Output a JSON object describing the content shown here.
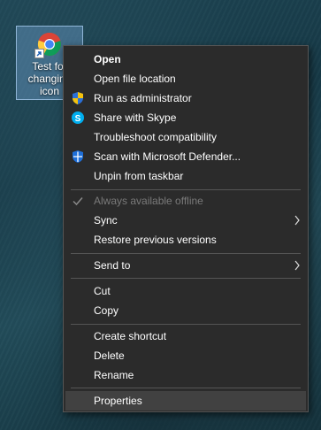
{
  "desktop": {
    "shortcut": {
      "label": "Test for changing icon",
      "icon": "chrome-icon"
    }
  },
  "menu": {
    "items": [
      {
        "label": "Open",
        "bold": true
      },
      {
        "label": "Open file location"
      },
      {
        "label": "Run as administrator",
        "icon": "uac-shield-icon"
      },
      {
        "label": "Share with Skype",
        "icon": "skype-icon"
      },
      {
        "label": "Troubleshoot compatibility"
      },
      {
        "label": "Scan with Microsoft Defender...",
        "icon": "defender-icon"
      },
      {
        "label": "Unpin from taskbar"
      },
      {
        "label": "Always available offline",
        "disabled": true,
        "checked": true,
        "icon": "checkmark-icon"
      },
      {
        "label": "Sync",
        "submenu": true,
        "icon": "chevron-right-icon"
      },
      {
        "label": "Restore previous versions"
      },
      {
        "label": "Send to",
        "submenu": true,
        "icon": "chevron-right-icon"
      },
      {
        "label": "Cut"
      },
      {
        "label": "Copy"
      },
      {
        "label": "Create shortcut"
      },
      {
        "label": "Delete"
      },
      {
        "label": "Rename"
      },
      {
        "label": "Properties",
        "highlighted": true
      }
    ],
    "colors": {
      "background": "#2b2b2b",
      "highlight": "#414141",
      "separator": "#555555",
      "disabled_text": "#7a7a7a"
    }
  }
}
